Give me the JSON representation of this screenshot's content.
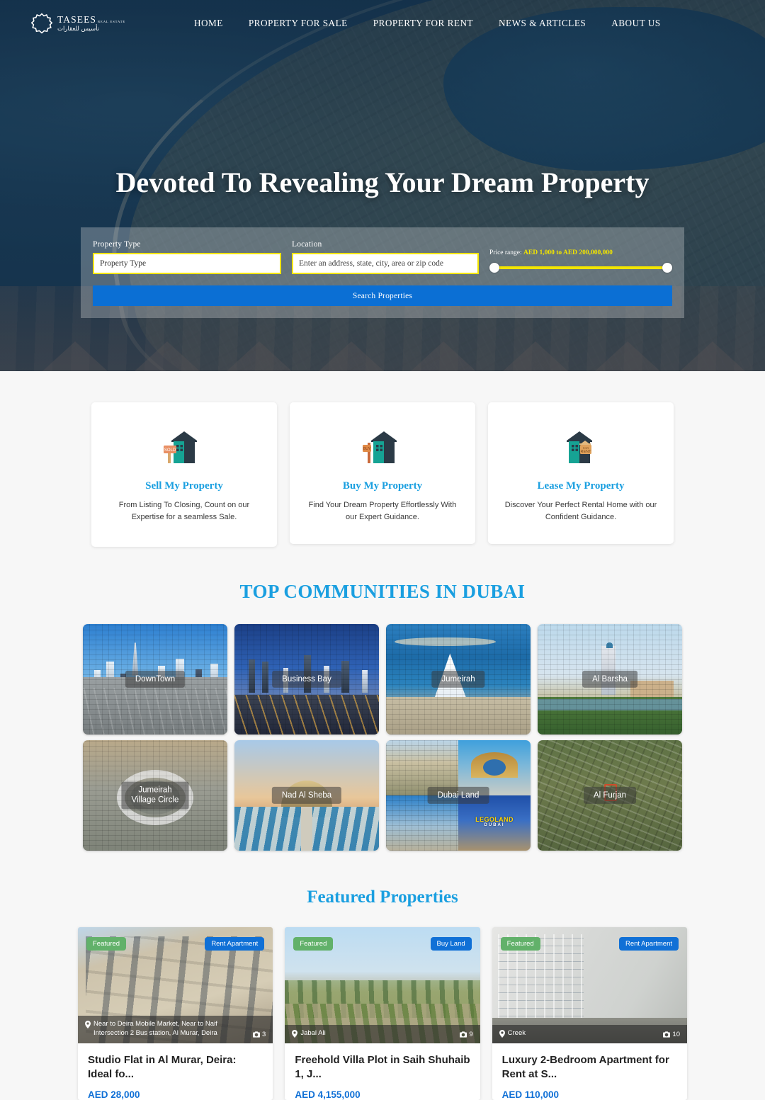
{
  "header": {
    "logo": {
      "name": "TASEES",
      "sub": "REAL ESTATE",
      "arabic": "تأسيس للعقارات",
      "mark_icon": "gear-star-logo-icon"
    },
    "nav": [
      {
        "label": "HOME"
      },
      {
        "label": "PROPERTY FOR SALE"
      },
      {
        "label": "PROPERTY FOR RENT"
      },
      {
        "label": "NEWS & ARTICLES"
      },
      {
        "label": "ABOUT US"
      }
    ]
  },
  "hero": {
    "title": "Devoted To Revealing Your Dream Property",
    "search": {
      "property_type": {
        "label": "Property Type",
        "value": "Property Type",
        "placeholder": "Property Type"
      },
      "location": {
        "label": "Location",
        "value": "",
        "placeholder": "Enter an address, state, city, area or zip code"
      },
      "price": {
        "prefix": "Price range:",
        "range": "AED 1,000 to AED 200,000,000",
        "min": "AED 1,000",
        "max": "AED 200,000,000"
      },
      "submit_label": "Search Properties"
    }
  },
  "services": [
    {
      "title": "Sell My Property",
      "desc": "From Listing To Closing, Count on our Expertise for a seamless Sale.",
      "icon": "house-sold-sign-icon",
      "sign": "SOLD"
    },
    {
      "title": "Buy My Property",
      "desc": "Find Your Dream Property Effortlessly With our Expert Guidance.",
      "icon": "house-buy-sign-icon",
      "sign": "BUY"
    },
    {
      "title": "Lease My Property",
      "desc": "Discover Your Perfect Rental Home with our Confident Guidance.",
      "icon": "house-rent-sign-icon",
      "sign": "FOR RENT"
    }
  ],
  "communities": {
    "title": "TOP COMMUNITIES IN DUBAI",
    "items": [
      {
        "label": "DownTown"
      },
      {
        "label": "Business Bay"
      },
      {
        "label": "Jumeirah"
      },
      {
        "label": "Al Barsha"
      },
      {
        "label": "Jumeirah\nVillage Circle"
      },
      {
        "label": "Nad Al Sheba"
      },
      {
        "label": "Dubai Land"
      },
      {
        "label": "Al Furjan"
      }
    ],
    "collage_brand": "LEGOLAND",
    "collage_brand_sub": "DUBAI"
  },
  "featured": {
    "title": "Featured Properties",
    "items": [
      {
        "badge_featured": "Featured",
        "badge_type": "Rent Apartment",
        "location": "Near to Deira Mobile Market, Near to Naif Intersection 2 Bus station, Al Murar, Deira",
        "photos": "3",
        "title": "Studio Flat in Al Murar, Deira: Ideal fo...",
        "price": "AED 28,000"
      },
      {
        "badge_featured": "Featured",
        "badge_type": "Buy Land",
        "location": "Jabal Ali",
        "photos": "9",
        "title": "Freehold Villa Plot in Saih Shuhaib 1, J...",
        "price": "AED 4,155,000"
      },
      {
        "badge_featured": "Featured",
        "badge_type": "Rent Apartment",
        "location": "Creek",
        "photos": "10",
        "title": "Luxury 2-Bedroom Apartment for Rent at S...",
        "price": "AED 110,000"
      }
    ],
    "icons": {
      "pin": "map-pin-icon",
      "camera": "camera-icon"
    }
  },
  "colors": {
    "accent_blue": "#1a9fe0",
    "button_blue": "#0b6fd4",
    "badge_green": "#62b16a",
    "badge_blue": "#1070d6",
    "slider_yellow": "#f2e500"
  }
}
